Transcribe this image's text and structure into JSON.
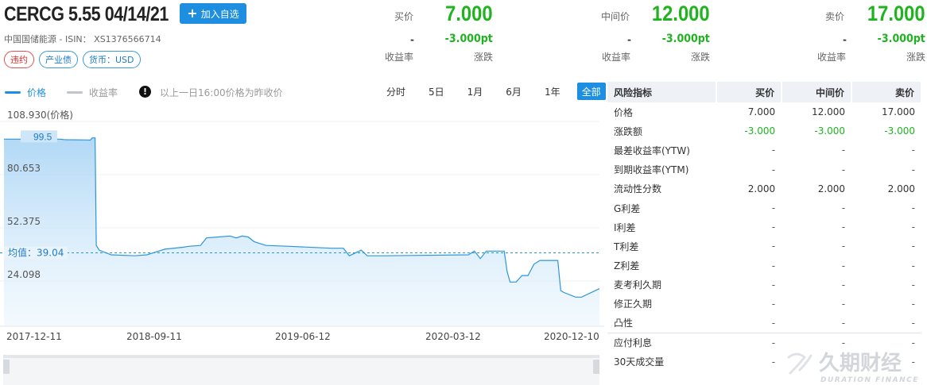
{
  "header": {
    "title": "CERCG 5.55 04/14/21",
    "add_button": "加入自选",
    "subline": "中国国储能源 - ISIN： XS1376566714",
    "tags": [
      "违约",
      "产业债",
      "货币：USD"
    ]
  },
  "quotes": [
    {
      "name": "买价",
      "price": "7.000",
      "dash": "-",
      "change": "-3.000pt",
      "yield_label": "收益率",
      "change_label": "涨跌"
    },
    {
      "name": "中间价",
      "price": "12.000",
      "dash": "-",
      "change": "-3.000pt",
      "yield_label": "收益率",
      "change_label": "涨跌"
    },
    {
      "name": "卖价",
      "price": "17.000",
      "dash": "-",
      "change": "-3.000pt",
      "yield_label": "收益率",
      "change_label": "涨跌"
    }
  ],
  "legend": {
    "price": "价格",
    "yield": "收益率",
    "note": "以上一日16:00价格为昨收价",
    "price_color": "#1e8fe0",
    "yield_color": "#c0c4cc"
  },
  "range_buttons": [
    "分时",
    "5日",
    "1月",
    "6月",
    "1年",
    "全部"
  ],
  "active_range": "全部",
  "chart_data": {
    "type": "area",
    "series": [
      {
        "name": "价格"
      }
    ],
    "y_ticks": [
      "108.930(价格)",
      "80.653",
      "52.375",
      "24.098"
    ],
    "ylim": [
      0,
      110
    ],
    "x_ticks": [
      "2017-12-11",
      "2018-09-11",
      "2019-06-12",
      "2020-03-12",
      "2020-12-10"
    ],
    "annotations": {
      "max_label": "99.5",
      "mean_label": "均值：39.04"
    },
    "mean": 39.04,
    "x": [
      0,
      0.095,
      0.1,
      0.105,
      0.14,
      0.145,
      0.148,
      0.153,
      0.155,
      0.16,
      0.18,
      0.22,
      0.24,
      0.26,
      0.27,
      0.3,
      0.31,
      0.33,
      0.34,
      0.36,
      0.38,
      0.39,
      0.4,
      0.41,
      0.42,
      0.44,
      0.48,
      0.55,
      0.57,
      0.58,
      0.6,
      0.61,
      0.62,
      0.64,
      0.78,
      0.79,
      0.8,
      0.81,
      0.82,
      0.84,
      0.845,
      0.85,
      0.86,
      0.87,
      0.88,
      0.89,
      0.9,
      0.905,
      0.91,
      0.93,
      0.935,
      0.94,
      0.96,
      0.97,
      1.0
    ],
    "y": [
      99.5,
      99.5,
      99.3,
      99.2,
      99.1,
      99.0,
      100.2,
      100.2,
      43,
      40.5,
      38,
      37.5,
      38,
      40,
      41,
      42,
      42.5,
      43,
      47,
      47.5,
      48,
      47,
      48,
      47.5,
      45,
      43,
      42.5,
      41.5,
      41.5,
      37.5,
      40.5,
      37.5,
      37.5,
      37.5,
      38,
      40,
      36,
      40,
      40,
      40,
      29,
      23.5,
      23.5,
      27,
      27,
      33,
      35,
      35,
      35,
      35,
      19,
      18,
      15.5,
      15.5,
      20
    ]
  },
  "risk_table": {
    "headers": [
      "风险指标",
      "买价",
      "中间价",
      "卖价"
    ],
    "rows": [
      [
        "价格",
        "7.000",
        "12.000",
        "17.000"
      ],
      [
        "涨跌额",
        "-3.000",
        "-3.000",
        "-3.000"
      ],
      [
        "最差收益率(YTW)",
        "-",
        "-",
        "-"
      ],
      [
        "到期收益率(YTM)",
        "-",
        "-",
        "-"
      ],
      [
        "流动性分数",
        "2.000",
        "2.000",
        "2.000"
      ],
      [
        "G利差",
        "-",
        "-",
        "-"
      ],
      [
        "I利差",
        "-",
        "-",
        "-"
      ],
      [
        "T利差",
        "-",
        "-",
        "-"
      ],
      [
        "Z利差",
        "-",
        "-",
        "-"
      ],
      [
        "麦考利久期",
        "-",
        "-",
        "-"
      ],
      [
        "修正久期",
        "-",
        "-",
        "-"
      ],
      [
        "凸性",
        "-",
        "-",
        "-"
      ],
      [
        "应付利息",
        "-",
        "-",
        "-"
      ],
      [
        "30天成交量",
        "-",
        "-",
        "-"
      ]
    ]
  },
  "watermark": {
    "cn": "久期财经",
    "en": "DURATION FINANCE"
  }
}
